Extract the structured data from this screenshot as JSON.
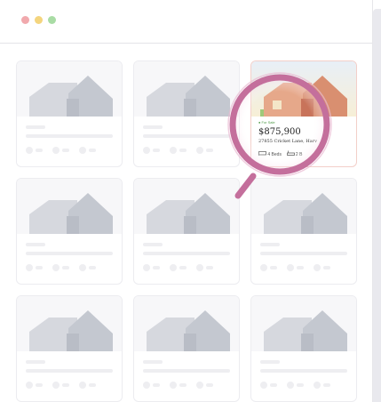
{
  "window": {
    "controls": [
      "close",
      "minimize",
      "maximize"
    ]
  },
  "colors": {
    "accent": "#c46f9c",
    "for_sale_green": "#4e9a46"
  },
  "grid": {
    "cards": [
      {
        "placeholder": true
      },
      {
        "placeholder": true
      },
      {
        "placeholder": false,
        "status": "For Sale",
        "price": "$875,900",
        "address": "27855 Cricket Lane, Harv",
        "beds": "4 Beds",
        "baths": "2 B"
      },
      {
        "placeholder": true
      },
      {
        "placeholder": true
      },
      {
        "placeholder": true
      },
      {
        "placeholder": true
      },
      {
        "placeholder": true
      },
      {
        "placeholder": true
      }
    ]
  },
  "icons": {
    "bed": "bed-icon",
    "bath": "bath-icon",
    "magnifier": "magnifying-glass-icon"
  }
}
